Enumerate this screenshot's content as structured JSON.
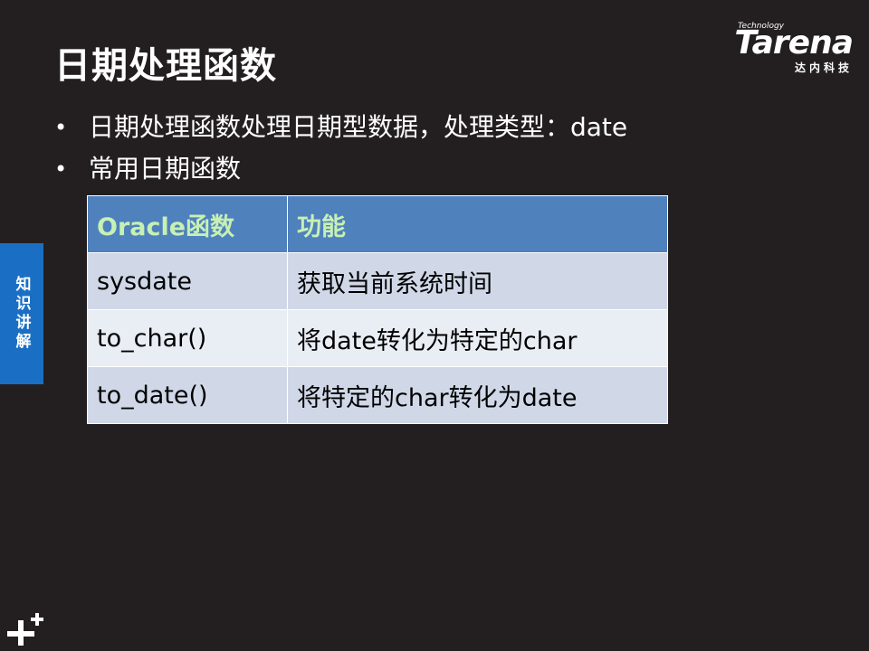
{
  "slide": {
    "title": "日期处理函数"
  },
  "logo": {
    "tech": "Technology",
    "brand": "Tarena",
    "cn": "达内科技"
  },
  "bullets": [
    "日期处理函数处理日期型数据，处理类型：date",
    "常用日期函数"
  ],
  "side_tab": {
    "label": "知识讲解"
  },
  "table": {
    "headers": [
      "Oracle函数",
      "功能"
    ],
    "rows": [
      [
        "sysdate",
        "获取当前系统时间"
      ],
      [
        "to_char()",
        "将date转化为特定的char"
      ],
      [
        "to_date()",
        "将特定的char转化为date"
      ]
    ]
  },
  "colors": {
    "background": "#231f20",
    "header_fill": "#4f81bd",
    "header_text": "#c7f0b4",
    "row_odd": "#d0d8e8",
    "row_even": "#e9edf4",
    "side_tab": "#1a6fc4"
  },
  "icons": {
    "corner": "plus-icon"
  }
}
